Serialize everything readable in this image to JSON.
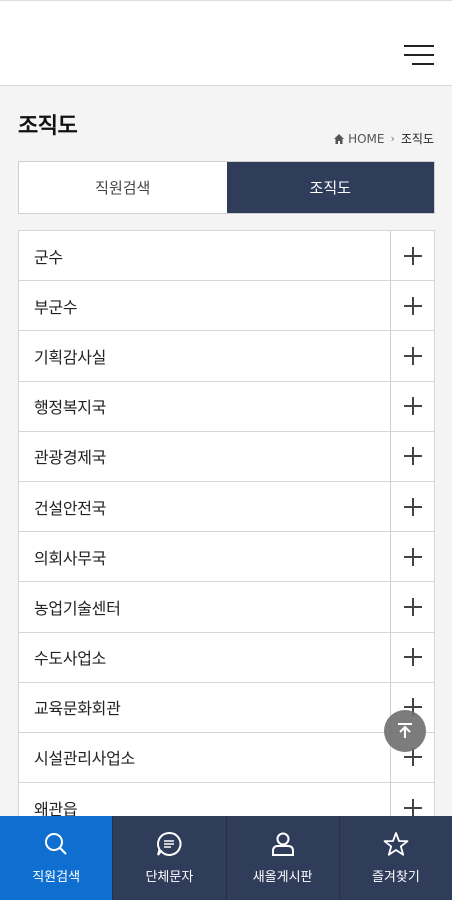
{
  "header": {
    "menu_icon": "hamburger-menu-icon"
  },
  "page": {
    "title": "조직도"
  },
  "breadcrumb": {
    "home": "HOME",
    "current": "조직도",
    "home_icon": "home-icon",
    "separator_icon": "chevron-right-icon"
  },
  "tabs": [
    {
      "label": "직원검색",
      "active": false
    },
    {
      "label": "조직도",
      "active": true
    }
  ],
  "org_list": [
    {
      "label": "군수"
    },
    {
      "label": "부군수"
    },
    {
      "label": "기획감사실"
    },
    {
      "label": "행정복지국"
    },
    {
      "label": "관광경제국"
    },
    {
      "label": "건설안전국"
    },
    {
      "label": "의회사무국"
    },
    {
      "label": "농업기술센터"
    },
    {
      "label": "수도사업소"
    },
    {
      "label": "교육문화회관"
    },
    {
      "label": "시설관리사업소"
    },
    {
      "label": "왜관읍"
    }
  ],
  "scroll_top": {
    "icon": "arrow-up-to-top-icon"
  },
  "bottom_nav": [
    {
      "label": "직원검색",
      "icon": "search-icon",
      "active": true
    },
    {
      "label": "단체문자",
      "icon": "chat-icon",
      "active": false
    },
    {
      "label": "새올게시판",
      "icon": "user-icon",
      "active": false
    },
    {
      "label": "즐겨찾기",
      "icon": "star-icon",
      "active": false
    }
  ],
  "colors": {
    "navy": "#2f3c5a",
    "active_blue": "#0e6fd0"
  }
}
